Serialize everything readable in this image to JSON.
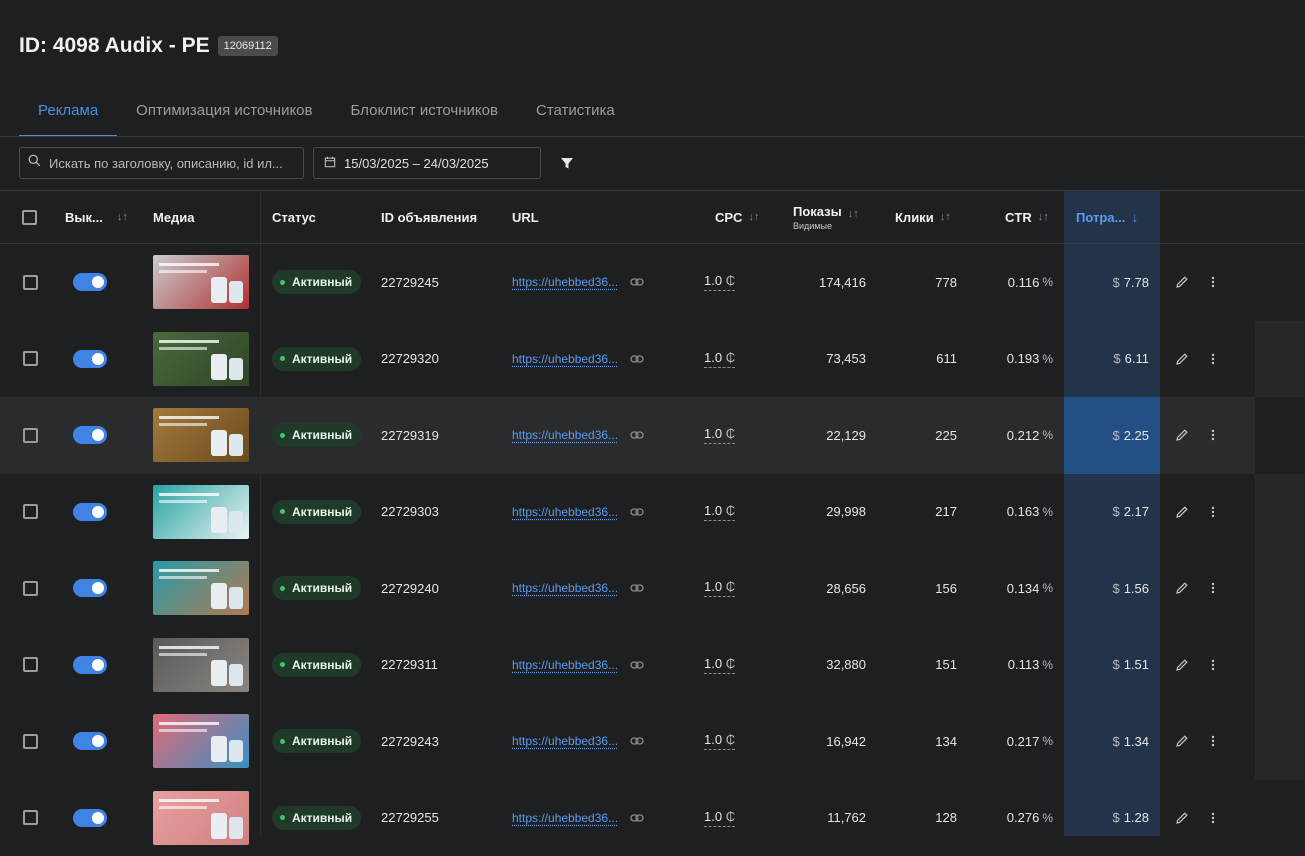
{
  "header": {
    "title": "ID: 4098 Audix - PE",
    "badge": "12069112"
  },
  "tabs": [
    {
      "label": "Реклама",
      "active": true
    },
    {
      "label": "Оптимизация источников",
      "active": false
    },
    {
      "label": "Блоклист источников",
      "active": false
    },
    {
      "label": "Статистика",
      "active": false
    }
  ],
  "toolbar": {
    "search_placeholder": "Искать по заголовку, описанию, id ил...",
    "date_range": "15/03/2025 – 24/03/2025"
  },
  "columns": {
    "toggle": "Вык...",
    "media": "Медиа",
    "status": "Статус",
    "ad_id": "ID объявления",
    "url": "URL",
    "cpc": "CPC",
    "impressions": "Показы",
    "impressions_sub": "Видимые",
    "clicks": "Клики",
    "ctr": "CTR",
    "spent": "Потра..."
  },
  "colors": {
    "accent": "#4a90e2",
    "status_green": "#44c46a",
    "spent_highlight": "#23344a"
  },
  "rows": [
    {
      "status": "Активный",
      "id": "22729245",
      "url": "https://uhebbed36...",
      "cpc": "1.0",
      "currency": "₵",
      "impressions": "174,416",
      "clicks": "778",
      "ctr": "0.116",
      "pct": "%",
      "dollar": "$",
      "spent": "7.78",
      "thumb": [
        "#c9ccd0",
        "#b03030"
      ]
    },
    {
      "status": "Активный",
      "id": "22729320",
      "url": "https://uhebbed36...",
      "cpc": "1.0",
      "currency": "₵",
      "impressions": "73,453",
      "clicks": "611",
      "ctr": "0.193",
      "pct": "%",
      "dollar": "$",
      "spent": "6.11",
      "thumb": [
        "#4a6a3a",
        "#2f4528"
      ]
    },
    {
      "status": "Активный",
      "id": "22729319",
      "url": "https://uhebbed36...",
      "cpc": "1.0",
      "currency": "₵",
      "impressions": "22,129",
      "clicks": "225",
      "ctr": "0.212",
      "pct": "%",
      "dollar": "$",
      "spent": "2.25",
      "thumb": [
        "#a27a3c",
        "#6b4a1e"
      ]
    },
    {
      "status": "Активный",
      "id": "22729303",
      "url": "https://uhebbed36...",
      "cpc": "1.0",
      "currency": "₵",
      "impressions": "29,998",
      "clicks": "217",
      "ctr": "0.163",
      "pct": "%",
      "dollar": "$",
      "spent": "2.17",
      "thumb": [
        "#2aa3a3",
        "#e9f3f3"
      ]
    },
    {
      "status": "Активный",
      "id": "22729240",
      "url": "https://uhebbed36...",
      "cpc": "1.0",
      "currency": "₵",
      "impressions": "28,656",
      "clicks": "156",
      "ctr": "0.134",
      "pct": "%",
      "dollar": "$",
      "spent": "1.56",
      "thumb": [
        "#2a9aa8",
        "#b07a50"
      ]
    },
    {
      "status": "Активный",
      "id": "22729311",
      "url": "https://uhebbed36...",
      "cpc": "1.0",
      "currency": "₵",
      "impressions": "32,880",
      "clicks": "151",
      "ctr": "0.113",
      "pct": "%",
      "dollar": "$",
      "spent": "1.51",
      "thumb": [
        "#5a5a5a",
        "#8a8580"
      ]
    },
    {
      "status": "Активный",
      "id": "22729243",
      "url": "https://uhebbed36...",
      "cpc": "1.0",
      "currency": "₵",
      "impressions": "16,942",
      "clicks": "134",
      "ctr": "0.217",
      "pct": "%",
      "dollar": "$",
      "spent": "1.34",
      "thumb": [
        "#e06a7a",
        "#3a90c0"
      ]
    },
    {
      "status": "Активный",
      "id": "22729255",
      "url": "https://uhebbed36...",
      "cpc": "1.0",
      "currency": "₵",
      "impressions": "11,762",
      "clicks": "128",
      "ctr": "0.276",
      "pct": "%",
      "dollar": "$",
      "spent": "1.28",
      "thumb": [
        "#e8a0a0",
        "#d08080"
      ]
    }
  ]
}
